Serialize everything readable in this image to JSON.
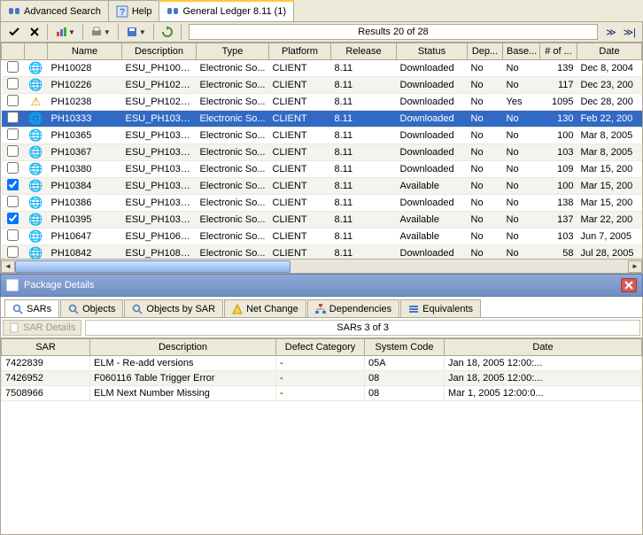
{
  "top_tabs": {
    "advanced": "Advanced Search",
    "help": "Help",
    "ledger": "General Ledger 8.11 (1)"
  },
  "toolbar": {
    "results_text": "Results 20 of 28"
  },
  "grid": {
    "columns": [
      "",
      "",
      "Name",
      "Description",
      "Type",
      "Platform",
      "Release",
      "Status",
      "Dep...",
      "Base...",
      "# of ...",
      "Date"
    ],
    "rows": [
      {
        "chk": false,
        "icon": "globe",
        "name": "PH10028",
        "desc": "ESU_PH1002...",
        "type": "Electronic So...",
        "plat": "CLIENT",
        "rel": "8.11",
        "status": "Downloaded",
        "dep": "No",
        "base": "No",
        "num": "139",
        "date": "Dec 8, 2004"
      },
      {
        "chk": false,
        "icon": "globe",
        "name": "PH10226",
        "desc": "ESU_PH1022...",
        "type": "Electronic So...",
        "plat": "CLIENT",
        "rel": "8.11",
        "status": "Downloaded",
        "dep": "No",
        "base": "No",
        "num": "117",
        "date": "Dec 23, 200"
      },
      {
        "chk": false,
        "icon": "warn",
        "name": "PH10238",
        "desc": "ESU_PH1023...",
        "type": "Electronic So...",
        "plat": "CLIENT",
        "rel": "8.11",
        "status": "Downloaded",
        "dep": "No",
        "base": "Yes",
        "num": "1095",
        "date": "Dec 28, 200"
      },
      {
        "chk": false,
        "icon": "globe",
        "name": "PH10333",
        "desc": "ESU_PH1033...",
        "type": "Electronic So...",
        "plat": "CLIENT",
        "rel": "8.11",
        "status": "Downloaded",
        "dep": "No",
        "base": "No",
        "num": "130",
        "date": "Feb 22, 200",
        "sel": true
      },
      {
        "chk": false,
        "icon": "globe",
        "name": "PH10365",
        "desc": "ESU_PH1036...",
        "type": "Electronic So...",
        "plat": "CLIENT",
        "rel": "8.11",
        "status": "Downloaded",
        "dep": "No",
        "base": "No",
        "num": "100",
        "date": "Mar 8, 2005"
      },
      {
        "chk": false,
        "icon": "globe",
        "name": "PH10367",
        "desc": "ESU_PH1036...",
        "type": "Electronic So...",
        "plat": "CLIENT",
        "rel": "8.11",
        "status": "Downloaded",
        "dep": "No",
        "base": "No",
        "num": "103",
        "date": "Mar 8, 2005"
      },
      {
        "chk": false,
        "icon": "globe",
        "name": "PH10380",
        "desc": "ESU_PH1038...",
        "type": "Electronic So...",
        "plat": "CLIENT",
        "rel": "8.11",
        "status": "Downloaded",
        "dep": "No",
        "base": "No",
        "num": "109",
        "date": "Mar 15, 200"
      },
      {
        "chk": true,
        "icon": "globe",
        "name": "PH10384",
        "desc": "ESU_PH1038...",
        "type": "Electronic So...",
        "plat": "CLIENT",
        "rel": "8.11",
        "status": "Available",
        "dep": "No",
        "base": "No",
        "num": "100",
        "date": "Mar 15, 200"
      },
      {
        "chk": false,
        "icon": "globe",
        "name": "PH10386",
        "desc": "ESU_PH1038...",
        "type": "Electronic So...",
        "plat": "CLIENT",
        "rel": "8.11",
        "status": "Downloaded",
        "dep": "No",
        "base": "No",
        "num": "138",
        "date": "Mar 15, 200"
      },
      {
        "chk": true,
        "icon": "globe",
        "name": "PH10395",
        "desc": "ESU_PH1039...",
        "type": "Electronic So...",
        "plat": "CLIENT",
        "rel": "8.11",
        "status": "Available",
        "dep": "No",
        "base": "No",
        "num": "137",
        "date": "Mar 22, 200"
      },
      {
        "chk": false,
        "icon": "globe",
        "name": "PH10647",
        "desc": "ESU_PH1064...",
        "type": "Electronic So...",
        "plat": "CLIENT",
        "rel": "8.11",
        "status": "Available",
        "dep": "No",
        "base": "No",
        "num": "103",
        "date": "Jun 7, 2005"
      },
      {
        "chk": false,
        "icon": "globe",
        "name": "PH10842",
        "desc": "ESU_PH1084...",
        "type": "Electronic So...",
        "plat": "CLIENT",
        "rel": "8.11",
        "status": "Downloaded",
        "dep": "No",
        "base": "No",
        "num": "58",
        "date": "Jul 28, 2005"
      }
    ]
  },
  "panel": {
    "title": "Package Details"
  },
  "dtabs": {
    "sars": "SARs",
    "objects": "Objects",
    "objects_by_sar": "Objects by SAR",
    "net_change": "Net Change",
    "dependencies": "Dependencies",
    "equivalents": "Equivalents"
  },
  "sar": {
    "details_btn": "SAR Details",
    "info": "SARs 3 of 3",
    "columns": [
      "SAR",
      "Description",
      "Defect Category",
      "System Code",
      "Date"
    ],
    "rows": [
      {
        "sar": "7422839",
        "desc": "ELM - Re-add versions",
        "cat": "-",
        "sys": "05A",
        "date": "Jan 18, 2005 12:00:..."
      },
      {
        "sar": "7426952",
        "desc": "F060116 Table Trigger Error",
        "cat": "-",
        "sys": "08",
        "date": "Jan 18, 2005 12:00:..."
      },
      {
        "sar": "7508966",
        "desc": "ELM Next Number Missing",
        "cat": "-",
        "sys": "08",
        "date": "Mar 1, 2005 12:00:0..."
      }
    ]
  }
}
